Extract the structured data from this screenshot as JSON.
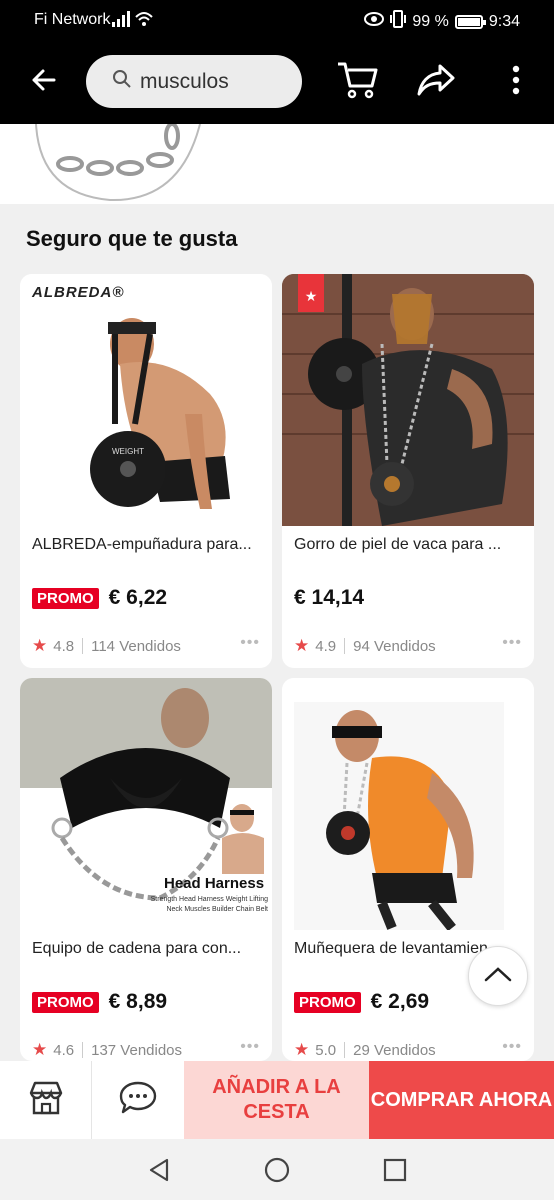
{
  "status_bar": {
    "carrier": "Fi Network",
    "battery": "99 %",
    "battery_level": 0.99,
    "time": "9:34"
  },
  "app_bar": {
    "search_query": "musculos",
    "icons": [
      "back-arrow-icon",
      "search-icon",
      "cart-icon",
      "share-icon",
      "more-vert-icon"
    ]
  },
  "section": {
    "title": "Seguro que te gusta"
  },
  "products": [
    {
      "brand": "ALBREDA®",
      "title": "ALBREDA-empuñadura para...",
      "promo": "PROMO",
      "price": "€ 6,22",
      "rating": "4.8",
      "sold": "114 Vendidos"
    },
    {
      "brand": "",
      "title": "Gorro de piel de vaca para ...",
      "promo": "",
      "price": "€ 14,14",
      "rating": "4.9",
      "sold": "94 Vendidos"
    },
    {
      "brand": "",
      "image_caption": "Head Harness",
      "image_subcaption_1": "Strength Head Harness Weight Lifting",
      "image_subcaption_2": "Neck Muscles Builder Chain Belt",
      "title": "Equipo de cadena para con...",
      "promo": "PROMO",
      "price": "€ 8,89",
      "rating": "4.6",
      "sold": "137 Vendidos"
    },
    {
      "brand": "",
      "title": "Muñequera de levantamien",
      "promo": "PROMO",
      "price": "€ 2,69",
      "rating": "5.0",
      "sold": "29 Vendidos"
    }
  ],
  "action_bar": {
    "add_to_cart": "AÑADIR A LA CESTA",
    "buy_now": "COMPRAR AHORA"
  },
  "colors": {
    "accent_red": "#ee4a4a",
    "promo_red": "#e60023",
    "cart_pink": "#fcd7d4"
  }
}
